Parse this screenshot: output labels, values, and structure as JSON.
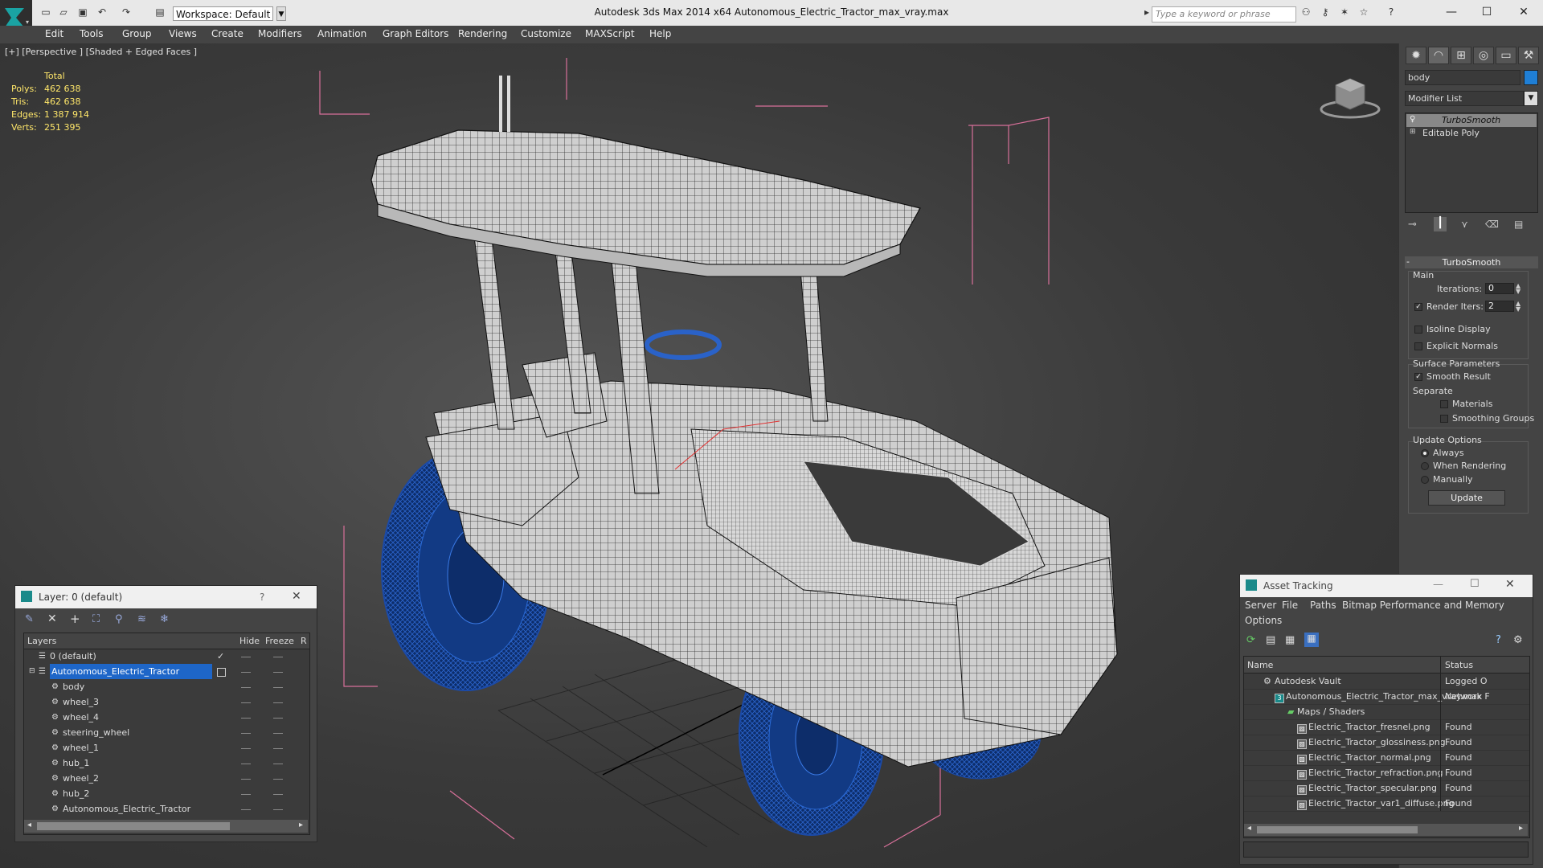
{
  "app": {
    "title": "Autodesk 3ds Max  2014 x64      Autonomous_Electric_Tractor_max_vray.max",
    "workspace": "Workspace: Default",
    "search_placeholder": "Type a keyword or phrase"
  },
  "menu": [
    "Edit",
    "Tools",
    "Group",
    "Views",
    "Create",
    "Modifiers",
    "Animation",
    "Graph Editors",
    "Rendering",
    "Customize",
    "MAXScript",
    "Help"
  ],
  "viewport": {
    "label": "[+] [Perspective ] [Shaded + Edged Faces ]",
    "stats": {
      "header": "Total",
      "rows": [
        {
          "label": "Polys:",
          "value": "462 638"
        },
        {
          "label": "Tris:",
          "value": "462 638"
        },
        {
          "label": "Edges:",
          "value": "1 387 914"
        },
        {
          "label": "Verts:",
          "value": "251 395"
        }
      ]
    }
  },
  "command_panel": {
    "object_name": "body",
    "object_color": "#1f7fd6",
    "modifier_list": "Modifier List",
    "stack": [
      "TurboSmooth",
      "Editable Poly"
    ],
    "turbosmooth": {
      "title": "TurboSmooth",
      "main_label": "Main",
      "iterations_label": "Iterations:",
      "iterations_value": "0",
      "render_iters_label": "Render Iters:",
      "render_iters_value": "2",
      "isoline": "Isoline Display",
      "explicit_normals": "Explicit Normals",
      "surface_params": "Surface Parameters",
      "smooth_result": "Smooth Result",
      "separate": "Separate",
      "materials": "Materials",
      "smoothing_groups": "Smoothing Groups",
      "update_options": "Update Options",
      "always": "Always",
      "when_rendering": "When Rendering",
      "manually": "Manually",
      "update_btn": "Update"
    }
  },
  "layer_dialog": {
    "title": "Layer: 0 (default)",
    "help": "?",
    "columns": {
      "layers": "Layers",
      "hide": "Hide",
      "freeze": "Freeze",
      "r": "R"
    },
    "rows": [
      {
        "name": "0 (default)",
        "level": 0
      },
      {
        "name": "Autonomous_Electric_Tractor",
        "level": 0
      },
      {
        "name": "body",
        "level": 1
      },
      {
        "name": "wheel_3",
        "level": 1
      },
      {
        "name": "wheel_4",
        "level": 1
      },
      {
        "name": "steering_wheel",
        "level": 1
      },
      {
        "name": "wheel_1",
        "level": 1
      },
      {
        "name": "hub_1",
        "level": 1
      },
      {
        "name": "wheel_2",
        "level": 1
      },
      {
        "name": "hub_2",
        "level": 1
      },
      {
        "name": "Autonomous_Electric_Tractor",
        "level": 1
      }
    ]
  },
  "asset_dialog": {
    "title": "Asset Tracking",
    "menu": [
      "Server",
      "File",
      "Paths",
      "Bitmap Performance and Memory",
      "Options"
    ],
    "columns": {
      "name": "Name",
      "status": "Status"
    },
    "rows": [
      {
        "name": "Autodesk Vault",
        "status": "Logged O",
        "indent": 0
      },
      {
        "name": "Autonomous_Electric_Tractor_max_vray.max",
        "status": "Network F",
        "indent": 1
      },
      {
        "name": "Maps / Shaders",
        "status": "",
        "indent": 2
      },
      {
        "name": "Electric_Tractor_fresnel.png",
        "status": "Found",
        "indent": 3
      },
      {
        "name": "Electric_Tractor_glossiness.png",
        "status": "Found",
        "indent": 3
      },
      {
        "name": "Electric_Tractor_normal.png",
        "status": "Found",
        "indent": 3
      },
      {
        "name": "Electric_Tractor_refraction.png",
        "status": "Found",
        "indent": 3
      },
      {
        "name": "Electric_Tractor_specular.png",
        "status": "Found",
        "indent": 3
      },
      {
        "name": "Electric_Tractor_var1_diffuse.png",
        "status": "Found",
        "indent": 3
      }
    ]
  }
}
